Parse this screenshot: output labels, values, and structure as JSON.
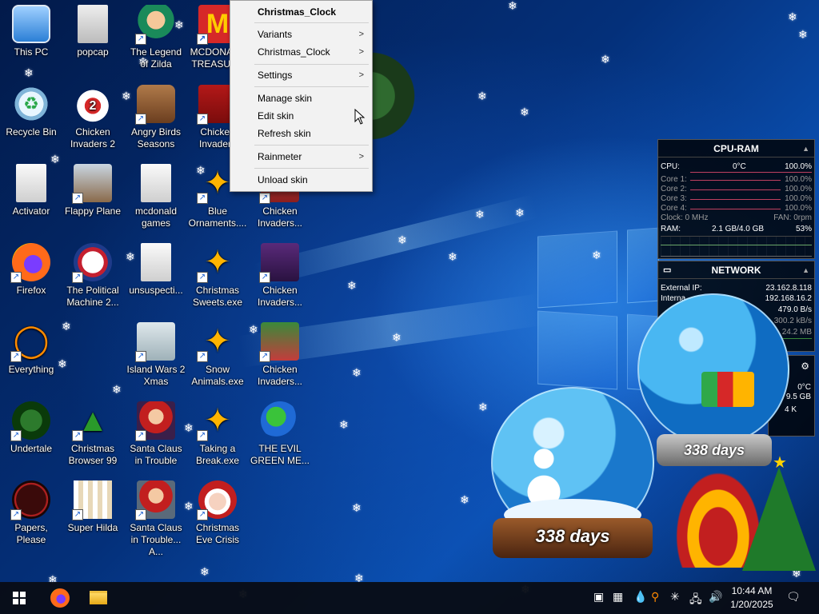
{
  "desktop": {
    "icons": [
      {
        "label": "This PC"
      },
      {
        "label": "popcap"
      },
      {
        "label": "The Legend of Zilda"
      },
      {
        "label": "MCDONALD TREASURE"
      },
      {
        "label": "Recycle Bin"
      },
      {
        "label": "Chicken Invaders 2"
      },
      {
        "label": "Angry Birds Seasons"
      },
      {
        "label": "Chicken Invaders"
      },
      {
        "label": "Activator"
      },
      {
        "label": "Flappy Plane"
      },
      {
        "label": "mcdonald games"
      },
      {
        "label": "Blue Ornaments...."
      },
      {
        "label": "Chicken Invaders..."
      },
      {
        "label": "Firefox"
      },
      {
        "label": "The Political Machine 2..."
      },
      {
        "label": "unsuspecti..."
      },
      {
        "label": "Christmas Sweets.exe"
      },
      {
        "label": "Chicken Invaders..."
      },
      {
        "label": "Everything"
      },
      {
        "label": "Island Wars 2 Xmas"
      },
      {
        "label": "Snow Animals.exe"
      },
      {
        "label": "Chicken Invaders..."
      },
      {
        "label": "Undertale"
      },
      {
        "label": "Christmas Browser 99"
      },
      {
        "label": "Santa Claus in Trouble"
      },
      {
        "label": "Taking a Break.exe"
      },
      {
        "label": "THE EVIL GREEN ME..."
      },
      {
        "label": "Papers, Please"
      },
      {
        "label": "Super Hilda"
      },
      {
        "label": "Santa Claus in Trouble... A..."
      },
      {
        "label": "Christmas Eve Crisis"
      }
    ]
  },
  "context_menu": {
    "title": "Christmas_Clock",
    "items": [
      {
        "label": "Variants",
        "submenu": ">"
      },
      {
        "label": "Christmas_Clock",
        "submenu": ">"
      },
      {
        "label": "Settings",
        "submenu": ">"
      },
      {
        "label": "Manage skin"
      },
      {
        "label": "Edit skin"
      },
      {
        "label": "Refresh skin"
      },
      {
        "label": "Rainmeter",
        "submenu": ">"
      },
      {
        "label": "Unload skin"
      }
    ]
  },
  "cpu_ram": {
    "title": "CPU-RAM",
    "cpu_label": "CPU:",
    "cpu_temp": "0°C",
    "cpu_value": "100.0%",
    "cores": [
      {
        "label": "Core 1:",
        "value": "100.0%"
      },
      {
        "label": "Core 2:",
        "value": "100.0%"
      },
      {
        "label": "Core 3:",
        "value": "100.0%"
      },
      {
        "label": "Core 4:",
        "value": "100.0%"
      }
    ],
    "clock": "Clock: 0 MHz",
    "fan": "FAN: 0rpm",
    "ram_label": "RAM:",
    "ram_value": "2.1 GB/4.0 GB",
    "ram_percent": "53%"
  },
  "network": {
    "title": "NETWORK",
    "external_ip_label": "External IP:",
    "external_ip": "23.162.8.118",
    "internal_label": "Interna",
    "internal_ip": "192.168.16.2",
    "up_rate": "479.0 B/s",
    "down_rate": "300.2 kB/s",
    "total": "24.2 MB"
  },
  "partial_panel": {
    "temp": "0°C",
    "size": "9.5 GB",
    "kb": "4 K"
  },
  "snow_globes": {
    "front_days": "338 days",
    "back_days": "338 days"
  },
  "taskbar": {
    "time": "10:44 AM",
    "date": "1/20/2025"
  },
  "colors": {
    "menu_bg": "#f2f2f2",
    "taskbar_bg": "#080c16",
    "panel_bg": "#000000"
  }
}
